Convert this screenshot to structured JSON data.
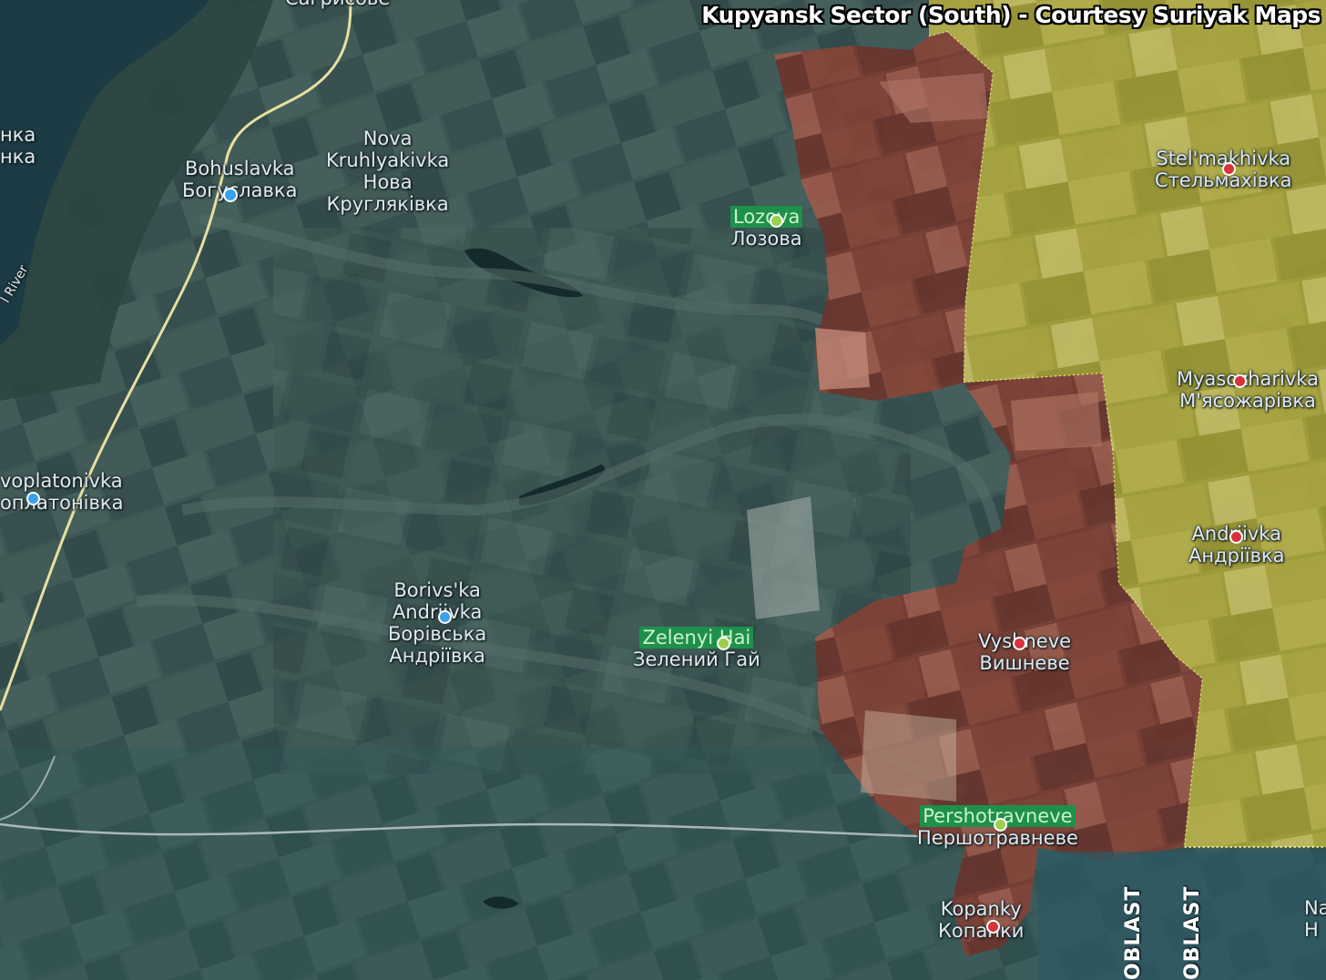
{
  "title": "Kupyansk Sector (South) - Courtesy Suriyak Maps",
  "colors": {
    "terrain": "#3a5552",
    "russian_controlled": "#8a3a2e",
    "ukrainian_controlled": "#b8b23a",
    "water": "#1c3b44",
    "road": "#e8dfa0",
    "label_highlight": "#1f8f4c"
  },
  "places": [
    {
      "id": "bohuslavka",
      "latin": "Bohuslavka",
      "cyrillic": "Богуславка",
      "marker": "blue"
    },
    {
      "id": "nova-kruhlyakivka",
      "latin_1": "Nova",
      "latin_2": "Kruhlyakivka",
      "cyrillic_1": "Нова",
      "cyrillic_2": "Кругляківка"
    },
    {
      "id": "lozova",
      "latin": "Lozova",
      "cyrillic": "Лозова",
      "marker": "green"
    },
    {
      "id": "stelmakhivka",
      "latin": "Stel'makhivka",
      "cyrillic": "Стельмахівка",
      "marker": "red"
    },
    {
      "id": "myasozharivka",
      "latin": "Myasozharivka",
      "cyrillic": "М'ясожарівка",
      "marker": "red"
    },
    {
      "id": "andriivka",
      "latin": "Andriivka",
      "cyrillic": "Андріївка",
      "marker": "red"
    },
    {
      "id": "novoplatonivka",
      "latin": "voplatonivka",
      "cyrillic": "оплатонівка",
      "marker": "blue"
    },
    {
      "id": "borivska-andriivka",
      "latin_1": "Borivs'ka",
      "latin_2": "Andriivka",
      "cyrillic_1": "Борівська",
      "cyrillic_2": "Андріївка",
      "marker": "blue"
    },
    {
      "id": "zelenyi-hai",
      "latin": "Zelenyi Hai",
      "cyrillic": "Зелений Гай",
      "marker": "green"
    },
    {
      "id": "vyshneve",
      "latin": "Vyshneve",
      "cyrillic": "Вишневе",
      "marker": "red"
    },
    {
      "id": "pershotravneve",
      "latin": "Pershotravneve",
      "cyrillic": "Першотравневе",
      "marker": "green"
    },
    {
      "id": "kopanky",
      "latin": "Kopanky",
      "cyrillic": "Копанки",
      "marker": "red"
    },
    {
      "id": "top-left-town",
      "latin": "нка",
      "cyrillic": "нка"
    },
    {
      "id": "top-center-town",
      "latin": "Сагрисове"
    }
  ],
  "features": {
    "river_label": "l River",
    "oblast_1": "OBLAST",
    "oblast_2": "OBLAST",
    "edge_label_1": "Na",
    "edge_label_2": "Н"
  }
}
